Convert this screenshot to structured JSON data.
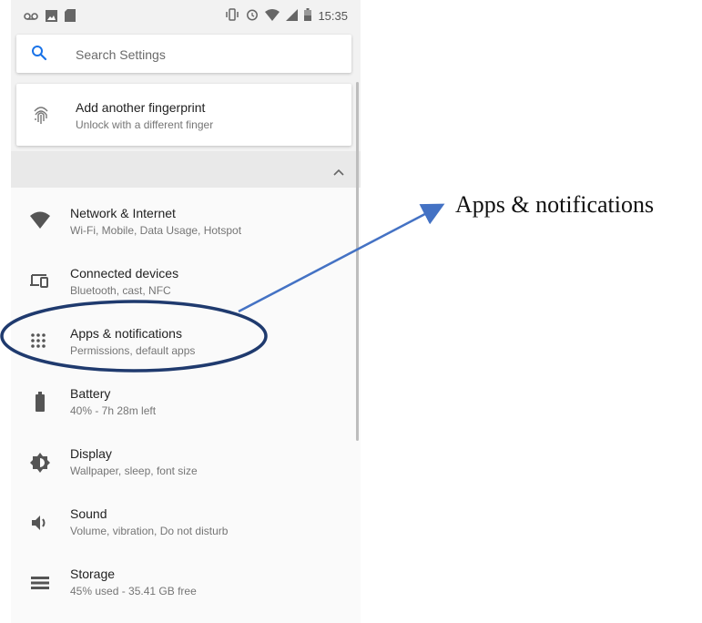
{
  "statusbar": {
    "time": "15:35",
    "left_icons": [
      "voicemail-icon",
      "image-icon",
      "sd-card-icon"
    ],
    "right_icons": [
      "vibrate-icon",
      "alarm-icon",
      "wifi-icon",
      "signal-icon",
      "battery-icon"
    ]
  },
  "search": {
    "placeholder": "Search Settings",
    "icon": "search-icon"
  },
  "suggestion": {
    "title": "Add another fingerprint",
    "subtitle": "Unlock with a different finger",
    "icon": "fingerprint-icon"
  },
  "collapse": {
    "icon": "chevron-up-icon"
  },
  "items": [
    {
      "title": "Network & Internet",
      "subtitle": "Wi-Fi, Mobile, Data Usage, Hotspot",
      "icon": "wifi-icon"
    },
    {
      "title": "Connected devices",
      "subtitle": "Bluetooth, cast, NFC",
      "icon": "devices-icon"
    },
    {
      "title": "Apps & notifications",
      "subtitle": "Permissions, default apps",
      "icon": "apps-grid-icon"
    },
    {
      "title": "Battery",
      "subtitle": "40% - 7h 28m left",
      "icon": "battery-icon"
    },
    {
      "title": "Display",
      "subtitle": "Wallpaper, sleep, font size",
      "icon": "brightness-icon"
    },
    {
      "title": "Sound",
      "subtitle": "Volume, vibration, Do not disturb",
      "icon": "volume-icon"
    },
    {
      "title": "Storage",
      "subtitle": "45% used - 35.41 GB free",
      "icon": "storage-icon"
    }
  ],
  "annotation": {
    "label": "Apps & notifications",
    "color": "#4472c4",
    "ellipse_color": "#1f3a6e"
  }
}
